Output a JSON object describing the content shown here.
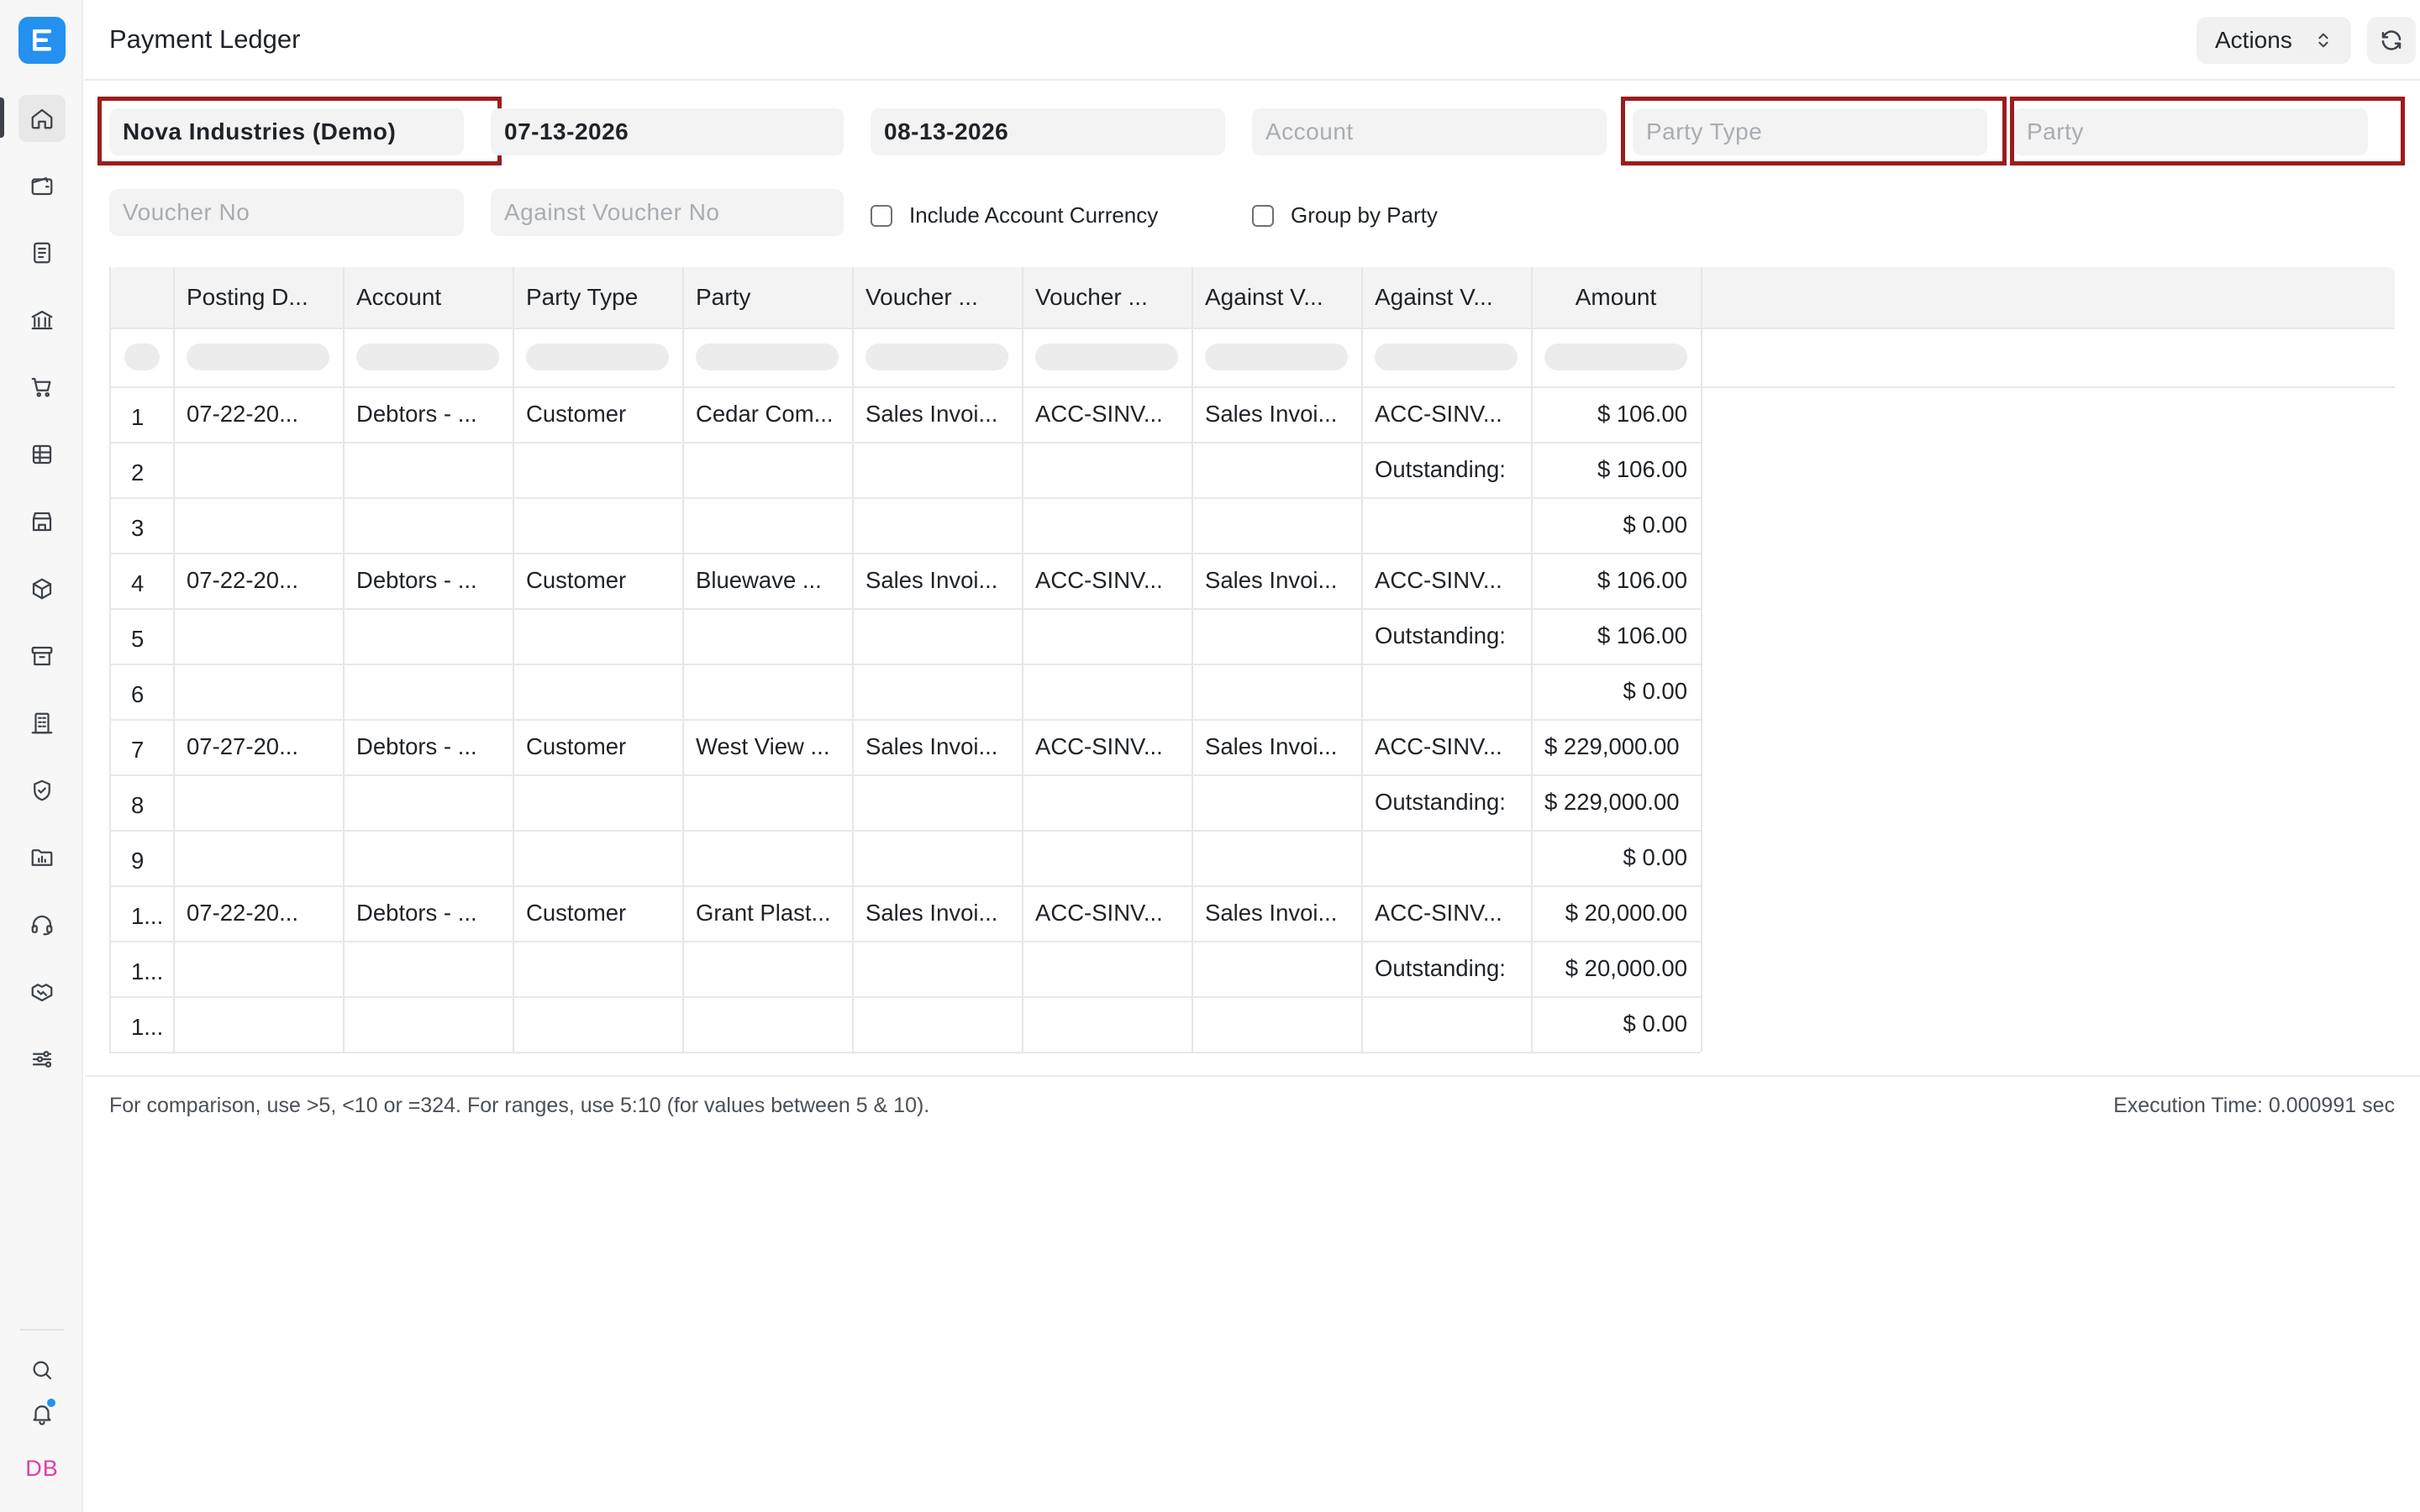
{
  "header": {
    "title": "Payment Ledger",
    "actions_label": "Actions"
  },
  "sidebar": {
    "items": [
      "home-icon",
      "wallet-icon",
      "file-text-icon",
      "bank-icon",
      "cart-icon",
      "table-icon",
      "store-icon",
      "package-icon",
      "archive-icon",
      "building-icon",
      "shield-icon",
      "folder-chart-icon",
      "headset-icon",
      "handshake-icon",
      "sliders-icon"
    ],
    "bottom": [
      "search-icon",
      "bell-icon"
    ],
    "avatar_initials": "DB"
  },
  "filters": {
    "company": "Nova Industries (Demo)",
    "from_date": "07-13-2026",
    "to_date": "08-13-2026",
    "account_placeholder": "Account",
    "party_type_placeholder": "Party Type",
    "party_placeholder": "Party",
    "voucher_no_placeholder": "Voucher No",
    "against_voucher_no_placeholder": "Against Voucher No",
    "include_account_currency": "Include Account Currency",
    "group_by_party": "Group by Party"
  },
  "table": {
    "columns": [
      "Posting D...",
      "Account",
      "Party Type",
      "Party",
      "Voucher ...",
      "Voucher ...",
      "Against V...",
      "Against V...",
      "Amount"
    ],
    "rows": [
      {
        "idx": "1",
        "cells": [
          "07-22-20...",
          "Debtors - ...",
          "Customer",
          "Cedar Com...",
          "Sales Invoi...",
          "ACC-SINV...",
          "Sales Invoi...",
          "ACC-SINV...",
          "$ 106.00"
        ]
      },
      {
        "idx": "2",
        "cells": [
          "",
          "",
          "",
          "",
          "",
          "",
          "",
          "Outstanding:",
          "$ 106.00"
        ]
      },
      {
        "idx": "3",
        "cells": [
          "",
          "",
          "",
          "",
          "",
          "",
          "",
          "",
          "$ 0.00"
        ]
      },
      {
        "idx": "4",
        "cells": [
          "07-22-20...",
          "Debtors - ...",
          "Customer",
          "Bluewave ...",
          "Sales Invoi...",
          "ACC-SINV...",
          "Sales Invoi...",
          "ACC-SINV...",
          "$ 106.00"
        ]
      },
      {
        "idx": "5",
        "cells": [
          "",
          "",
          "",
          "",
          "",
          "",
          "",
          "Outstanding:",
          "$ 106.00"
        ]
      },
      {
        "idx": "6",
        "cells": [
          "",
          "",
          "",
          "",
          "",
          "",
          "",
          "",
          "$ 0.00"
        ]
      },
      {
        "idx": "7",
        "cells": [
          "07-27-20...",
          "Debtors - ...",
          "Customer",
          "West View ...",
          "Sales Invoi...",
          "ACC-SINV...",
          "Sales Invoi...",
          "ACC-SINV...",
          "$ 229,000.00"
        ]
      },
      {
        "idx": "8",
        "cells": [
          "",
          "",
          "",
          "",
          "",
          "",
          "",
          "Outstanding:",
          "$ 229,000.00"
        ]
      },
      {
        "idx": "9",
        "cells": [
          "",
          "",
          "",
          "",
          "",
          "",
          "",
          "",
          "$ 0.00"
        ]
      },
      {
        "idx": "1...",
        "cells": [
          "07-22-20...",
          "Debtors - ...",
          "Customer",
          "Grant Plast...",
          "Sales Invoi...",
          "ACC-SINV...",
          "Sales Invoi...",
          "ACC-SINV...",
          "$ 20,000.00"
        ]
      },
      {
        "idx": "1...",
        "cells": [
          "",
          "",
          "",
          "",
          "",
          "",
          "",
          "Outstanding:",
          "$ 20,000.00"
        ]
      },
      {
        "idx": "1...",
        "cells": [
          "",
          "",
          "",
          "",
          "",
          "",
          "",
          "",
          "$ 0.00"
        ]
      }
    ]
  },
  "footer": {
    "hint": "For comparison, use >5, <10 or =324. For ranges, use 5:10 (for values between 5 & 10).",
    "execution_time": "Execution Time: 0.000991 sec"
  },
  "colors": {
    "accent": "#2490ef",
    "highlight_border": "#9b1c1c",
    "avatar": "#e03fa3"
  }
}
